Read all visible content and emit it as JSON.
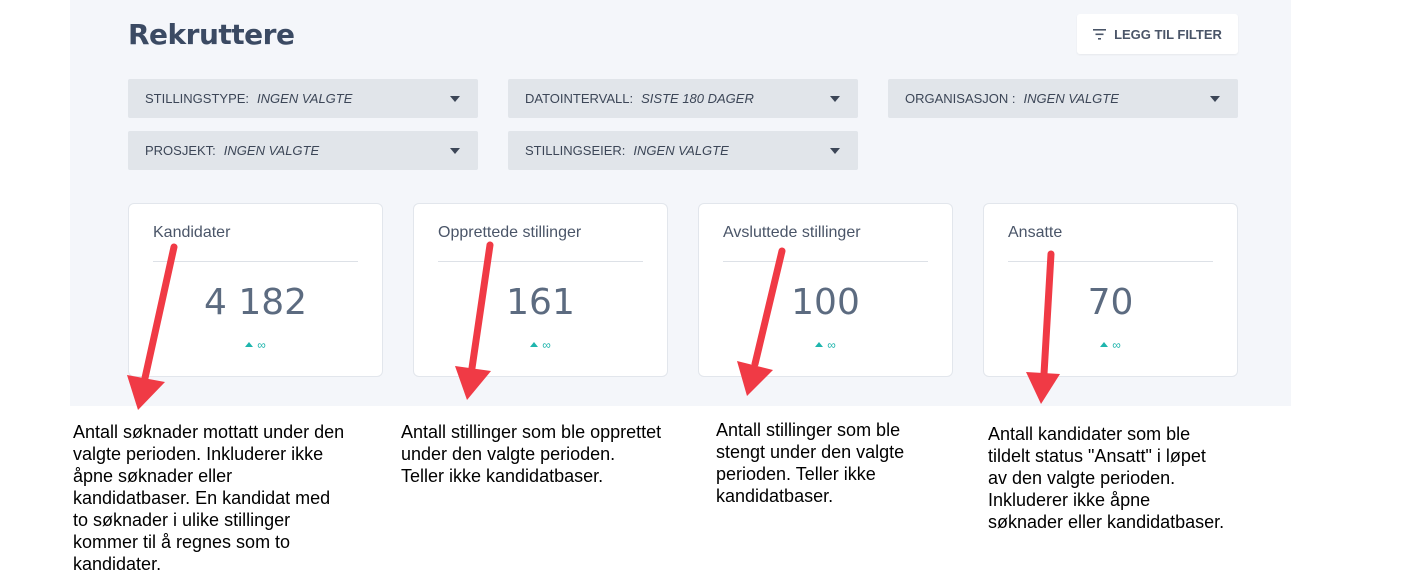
{
  "page": {
    "title": "Rekruttere"
  },
  "toolbar": {
    "filter_button": "LEGG TIL FILTER"
  },
  "filters": [
    {
      "key": "STILLINGSTYPE:",
      "value": "INGEN VALGTE"
    },
    {
      "key": "DATOINTERVALL:",
      "value": "SISTE 180 DAGER"
    },
    {
      "key": "ORGANISASJON :",
      "value": "INGEN VALGTE"
    },
    {
      "key": "PROSJEKT:",
      "value": "INGEN VALGTE"
    },
    {
      "key": "STILLINGSEIER:",
      "value": "INGEN VALGTE"
    }
  ],
  "cards": [
    {
      "label": "Kandidater",
      "value": "4 182",
      "trend": "∞"
    },
    {
      "label": "Opprettede stillinger",
      "value": "161",
      "trend": "∞"
    },
    {
      "label": "Avsluttede stillinger",
      "value": "100",
      "trend": "∞"
    },
    {
      "label": "Ansatte",
      "value": "70",
      "trend": "∞"
    }
  ],
  "annotations": [
    {
      "lines": [
        "Antall søknader mottatt under den",
        "valgte perioden. Inkluderer ikke",
        "åpne søknader eller",
        "kandidatbaser. En kandidat med",
        "to søknader i ulike stillinger",
        "kommer til å regnes som to",
        "kandidater."
      ]
    },
    {
      "lines": [
        "Antall stillinger som ble opprettet",
        "under den valgte perioden.",
        "Teller ikke kandidatbaser."
      ]
    },
    {
      "lines": [
        "Antall stillinger som ble",
        "stengt under den valgte",
        "perioden. Teller ikke",
        "kandidatbaser."
      ]
    },
    {
      "lines": [
        "Antall kandidater som ble",
        "tildelt status \"Ansatt\" i løpet",
        "av den valgte perioden.",
        "Inkluderer ikke åpne",
        "søknader eller kandidatbaser."
      ]
    }
  ],
  "colors": {
    "arrow": "#f03a45",
    "trend": "#1fb5ad",
    "title": "#3b4a63"
  }
}
